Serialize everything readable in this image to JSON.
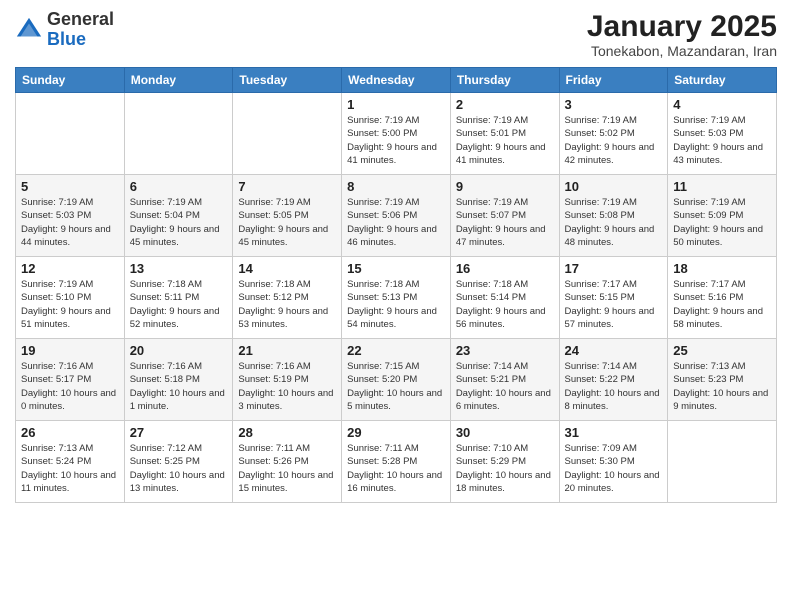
{
  "header": {
    "logo": {
      "general": "General",
      "blue": "Blue"
    },
    "title": "January 2025",
    "location": "Tonekabon, Mazandaran, Iran"
  },
  "weekdays": [
    "Sunday",
    "Monday",
    "Tuesday",
    "Wednesday",
    "Thursday",
    "Friday",
    "Saturday"
  ],
  "weeks": [
    [
      {
        "day": "",
        "info": ""
      },
      {
        "day": "",
        "info": ""
      },
      {
        "day": "",
        "info": ""
      },
      {
        "day": "1",
        "info": "Sunrise: 7:19 AM\nSunset: 5:00 PM\nDaylight: 9 hours and 41 minutes."
      },
      {
        "day": "2",
        "info": "Sunrise: 7:19 AM\nSunset: 5:01 PM\nDaylight: 9 hours and 41 minutes."
      },
      {
        "day": "3",
        "info": "Sunrise: 7:19 AM\nSunset: 5:02 PM\nDaylight: 9 hours and 42 minutes."
      },
      {
        "day": "4",
        "info": "Sunrise: 7:19 AM\nSunset: 5:03 PM\nDaylight: 9 hours and 43 minutes."
      }
    ],
    [
      {
        "day": "5",
        "info": "Sunrise: 7:19 AM\nSunset: 5:03 PM\nDaylight: 9 hours and 44 minutes."
      },
      {
        "day": "6",
        "info": "Sunrise: 7:19 AM\nSunset: 5:04 PM\nDaylight: 9 hours and 45 minutes."
      },
      {
        "day": "7",
        "info": "Sunrise: 7:19 AM\nSunset: 5:05 PM\nDaylight: 9 hours and 45 minutes."
      },
      {
        "day": "8",
        "info": "Sunrise: 7:19 AM\nSunset: 5:06 PM\nDaylight: 9 hours and 46 minutes."
      },
      {
        "day": "9",
        "info": "Sunrise: 7:19 AM\nSunset: 5:07 PM\nDaylight: 9 hours and 47 minutes."
      },
      {
        "day": "10",
        "info": "Sunrise: 7:19 AM\nSunset: 5:08 PM\nDaylight: 9 hours and 48 minutes."
      },
      {
        "day": "11",
        "info": "Sunrise: 7:19 AM\nSunset: 5:09 PM\nDaylight: 9 hours and 50 minutes."
      }
    ],
    [
      {
        "day": "12",
        "info": "Sunrise: 7:19 AM\nSunset: 5:10 PM\nDaylight: 9 hours and 51 minutes."
      },
      {
        "day": "13",
        "info": "Sunrise: 7:18 AM\nSunset: 5:11 PM\nDaylight: 9 hours and 52 minutes."
      },
      {
        "day": "14",
        "info": "Sunrise: 7:18 AM\nSunset: 5:12 PM\nDaylight: 9 hours and 53 minutes."
      },
      {
        "day": "15",
        "info": "Sunrise: 7:18 AM\nSunset: 5:13 PM\nDaylight: 9 hours and 54 minutes."
      },
      {
        "day": "16",
        "info": "Sunrise: 7:18 AM\nSunset: 5:14 PM\nDaylight: 9 hours and 56 minutes."
      },
      {
        "day": "17",
        "info": "Sunrise: 7:17 AM\nSunset: 5:15 PM\nDaylight: 9 hours and 57 minutes."
      },
      {
        "day": "18",
        "info": "Sunrise: 7:17 AM\nSunset: 5:16 PM\nDaylight: 9 hours and 58 minutes."
      }
    ],
    [
      {
        "day": "19",
        "info": "Sunrise: 7:16 AM\nSunset: 5:17 PM\nDaylight: 10 hours and 0 minutes."
      },
      {
        "day": "20",
        "info": "Sunrise: 7:16 AM\nSunset: 5:18 PM\nDaylight: 10 hours and 1 minute."
      },
      {
        "day": "21",
        "info": "Sunrise: 7:16 AM\nSunset: 5:19 PM\nDaylight: 10 hours and 3 minutes."
      },
      {
        "day": "22",
        "info": "Sunrise: 7:15 AM\nSunset: 5:20 PM\nDaylight: 10 hours and 5 minutes."
      },
      {
        "day": "23",
        "info": "Sunrise: 7:14 AM\nSunset: 5:21 PM\nDaylight: 10 hours and 6 minutes."
      },
      {
        "day": "24",
        "info": "Sunrise: 7:14 AM\nSunset: 5:22 PM\nDaylight: 10 hours and 8 minutes."
      },
      {
        "day": "25",
        "info": "Sunrise: 7:13 AM\nSunset: 5:23 PM\nDaylight: 10 hours and 9 minutes."
      }
    ],
    [
      {
        "day": "26",
        "info": "Sunrise: 7:13 AM\nSunset: 5:24 PM\nDaylight: 10 hours and 11 minutes."
      },
      {
        "day": "27",
        "info": "Sunrise: 7:12 AM\nSunset: 5:25 PM\nDaylight: 10 hours and 13 minutes."
      },
      {
        "day": "28",
        "info": "Sunrise: 7:11 AM\nSunset: 5:26 PM\nDaylight: 10 hours and 15 minutes."
      },
      {
        "day": "29",
        "info": "Sunrise: 7:11 AM\nSunset: 5:28 PM\nDaylight: 10 hours and 16 minutes."
      },
      {
        "day": "30",
        "info": "Sunrise: 7:10 AM\nSunset: 5:29 PM\nDaylight: 10 hours and 18 minutes."
      },
      {
        "day": "31",
        "info": "Sunrise: 7:09 AM\nSunset: 5:30 PM\nDaylight: 10 hours and 20 minutes."
      },
      {
        "day": "",
        "info": ""
      }
    ]
  ]
}
